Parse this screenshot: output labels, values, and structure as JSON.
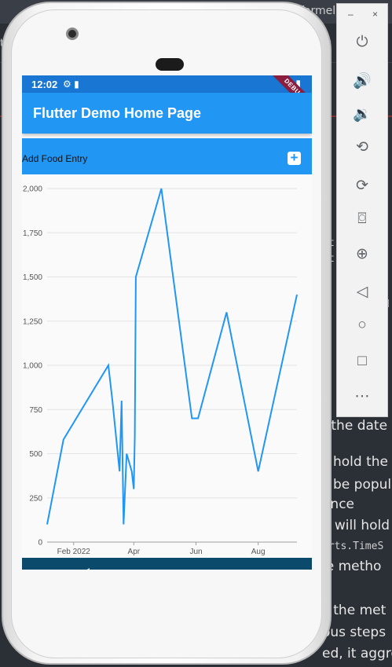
{
  "ide": {
    "top_fragment": "formel",
    "tab_fragment_left": "ta",
    "tab_fragment_right": "rs",
    "lines": [
      "f the date",
      "hold the",
      "be popula",
      "ance",
      "e will hold",
      "arts.TimeS",
      "le metho",
      "s the met",
      "ous steps",
      "ed, it aggreg"
    ],
    "code_fragments": [
      "t",
      "t",
      "d"
    ]
  },
  "phone": {
    "status": {
      "time": "12:02",
      "icons": "⚙ ▮",
      "right_icons": "▾ ▮",
      "debug_banner": "DEBUG"
    },
    "appbar": {
      "title": "Flutter Demo Home Page"
    },
    "entry": {
      "label": "Add Food Entry",
      "add_icon": "plus-icon"
    },
    "nav": {
      "back": "back-icon",
      "home": "home-icon",
      "recents": "recents-icon"
    }
  },
  "emulator": {
    "window": {
      "minimize": "–",
      "close": "×"
    },
    "tools": [
      "power-icon",
      "volume-up-icon",
      "volume-down-icon",
      "rotate-left-icon",
      "rotate-right-icon",
      "camera-icon",
      "zoom-icon",
      "back-icon",
      "home-icon",
      "overview-icon",
      "more-icon"
    ]
  },
  "chart_data": {
    "type": "line",
    "ylim": [
      0,
      2000
    ],
    "yticks": [
      "0",
      "250",
      "500",
      "750",
      "1,000",
      "1,250",
      "1,500",
      "1,750",
      "2,000"
    ],
    "xticks": [
      "Feb 2022",
      "Apr",
      "Jun",
      "Aug"
    ],
    "xtick_dates": [
      "2022-02-01",
      "2022-04-01",
      "2022-06-01",
      "2022-08-01"
    ],
    "xlim": [
      "2022-01-06",
      "2022-09-08"
    ],
    "line_color": "#2196f3",
    "series": [
      {
        "points": [
          {
            "x": "2022-01-06",
            "y": 100
          },
          {
            "x": "2022-01-22",
            "y": 580
          },
          {
            "x": "2022-03-07",
            "y": 1000
          },
          {
            "x": "2022-03-11",
            "y": 800
          },
          {
            "x": "2022-03-18",
            "y": 400
          },
          {
            "x": "2022-03-20",
            "y": 800
          },
          {
            "x": "2022-03-22",
            "y": 100
          },
          {
            "x": "2022-03-25",
            "y": 500
          },
          {
            "x": "2022-03-30",
            "y": 400
          },
          {
            "x": "2022-04-01",
            "y": 300
          },
          {
            "x": "2022-04-02",
            "y": 600
          },
          {
            "x": "2022-04-03",
            "y": 1500
          },
          {
            "x": "2022-04-28",
            "y": 2000
          },
          {
            "x": "2022-05-28",
            "y": 700
          },
          {
            "x": "2022-06-03",
            "y": 700
          },
          {
            "x": "2022-07-01",
            "y": 1300
          },
          {
            "x": "2022-08-01",
            "y": 400
          },
          {
            "x": "2022-09-08",
            "y": 1400
          }
        ]
      }
    ]
  }
}
